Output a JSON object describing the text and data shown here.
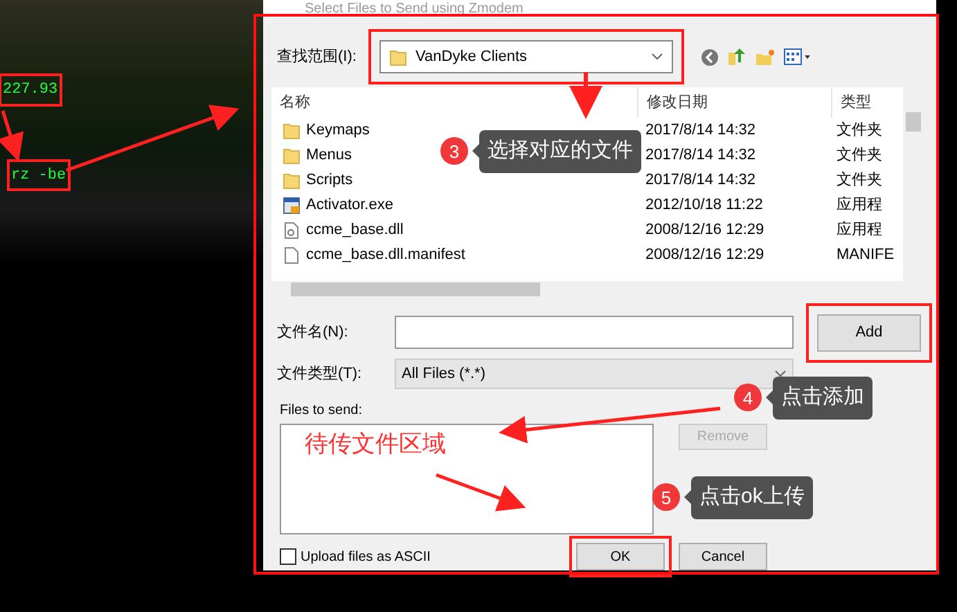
{
  "terminal": {
    "lines": [
      {
        "text": "227.93",
        "highlighted": true
      },
      {
        "text": "rz -be",
        "highlighted": true
      }
    ]
  },
  "dialog": {
    "title": "Select Files to Send using Zmodem",
    "look_in": {
      "label": "查找范围(I):",
      "value": "VanDyke Clients",
      "highlighted": true
    },
    "file_list": {
      "columns": [
        "名称",
        "修改日期",
        "类型"
      ],
      "rows": [
        {
          "kind": "folder",
          "name": "Keymaps",
          "modified": "2017/8/14 14:32",
          "type": "文件夹"
        },
        {
          "kind": "folder",
          "name": "Menus",
          "modified": "2017/8/14 14:32",
          "type": "文件夹"
        },
        {
          "kind": "folder",
          "name": "Scripts",
          "modified": "2017/8/14 14:32",
          "type": "文件夹"
        },
        {
          "kind": "exe",
          "name": "Activator.exe",
          "modified": "2012/10/18 11:22",
          "type": "应用程"
        },
        {
          "kind": "dll",
          "name": "ccme_base.dll",
          "modified": "2008/12/16 12:29",
          "type": "应用程"
        },
        {
          "kind": "file",
          "name": "ccme_base.dll.manifest",
          "modified": "2008/12/16 12:29",
          "type": "MANIFE"
        }
      ]
    },
    "file_name": {
      "label": "文件名(N):"
    },
    "file_type": {
      "label": "文件类型(T):",
      "value": "All Files (*.*)"
    },
    "add_button": {
      "label": "Add",
      "highlighted": true
    },
    "files_to_send": {
      "label": "Files to send:"
    },
    "remove_button": {
      "label": "Remove",
      "disabled": true
    },
    "ascii_checkbox": {
      "label": "Upload files as ASCII",
      "checked": false
    },
    "buttons": [
      {
        "label": "OK",
        "highlighted": true
      },
      {
        "label": "Cancel",
        "highlighted": false
      }
    ]
  },
  "annotations": {
    "callouts": [
      {
        "number": "3",
        "text": "选择对应的文件"
      },
      {
        "number": "4",
        "text": "点击添加"
      },
      {
        "number": "5",
        "text": "点击ok上传"
      }
    ],
    "area_label": "待传文件区域"
  }
}
